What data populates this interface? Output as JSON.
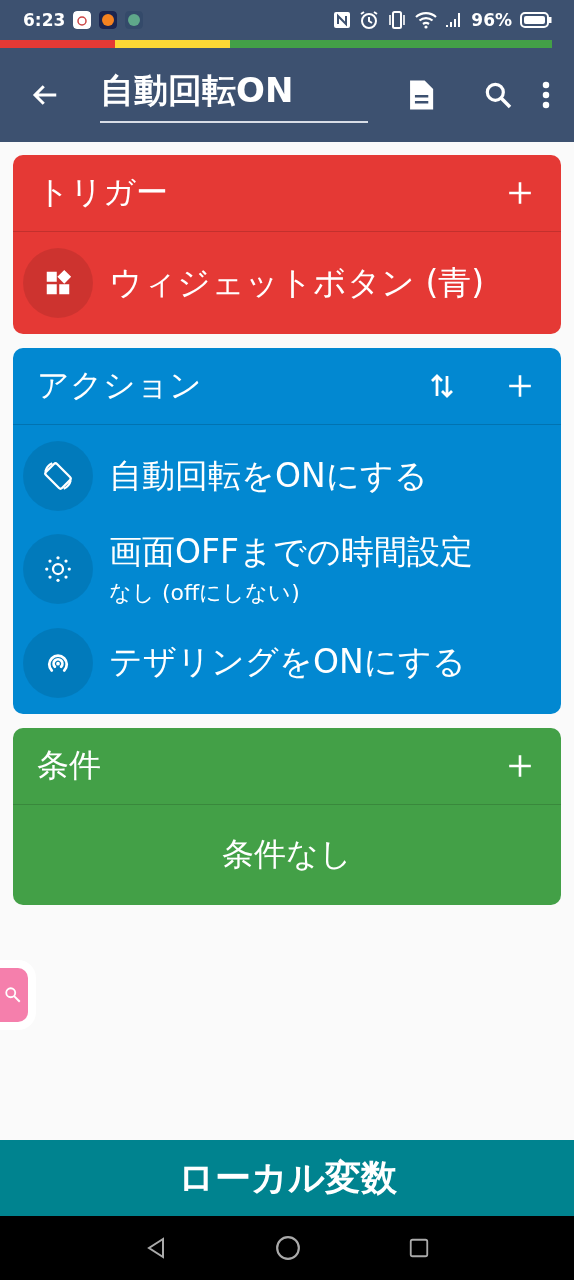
{
  "status_bar": {
    "time": "6:23",
    "battery": "96%"
  },
  "toolbar": {
    "title": "自動回転ON"
  },
  "sections": [
    {
      "title": "トリガー",
      "color": "#e53935",
      "reorder": false,
      "items": [
        {
          "kind": "widget",
          "label": "ウィジェットボタン (青)"
        }
      ]
    },
    {
      "title": "アクション",
      "color": "#0288d1",
      "reorder": true,
      "items": [
        {
          "kind": "rotate",
          "label": "自動回転をONにする"
        },
        {
          "kind": "brightness",
          "label": "画面OFFまでの時間設定",
          "detail": "なし (offにしない)"
        },
        {
          "kind": "hotspot",
          "label": "テザリングをONにする"
        }
      ]
    },
    {
      "title": "条件",
      "color": "#43a047",
      "reorder": false,
      "empty_text": "条件なし"
    }
  ],
  "bottom_button": "ローカル変数"
}
